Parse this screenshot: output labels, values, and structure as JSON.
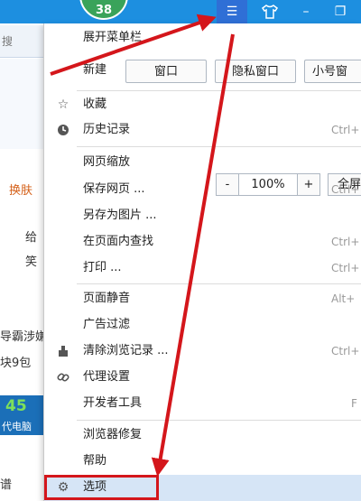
{
  "titlebar": {
    "badge": "38",
    "menu_icon": "hamburger-icon",
    "shirt_icon": "tshirt-icon",
    "min_icon": "minimize-icon",
    "max_icon": "restore-icon",
    "menu_glyph": "☰",
    "min_glyph": "–",
    "max_glyph": "❐"
  },
  "background_page": {
    "search_text": "搜",
    "nav_text": "换肤",
    "line1": "给",
    "line2": "笑",
    "news1": "导霸涉嫌",
    "news2": "块9包",
    "ad_top": "45",
    "ad_bottom": "代电脑",
    "last": "谱"
  },
  "menu": {
    "expand_menubar": "展开菜单栏",
    "new": {
      "label": "新建",
      "window": "窗口",
      "private_window": "隐私窗口",
      "small_window": "小号窗"
    },
    "favorites": {
      "label": "收藏",
      "icon": "star-icon"
    },
    "history": {
      "label": "历史记录",
      "icon": "clock-icon",
      "shortcut": "Ctrl+"
    },
    "zoom": {
      "label": "网页缩放",
      "minus": "-",
      "value": "100%",
      "plus": "+",
      "fullscreen": "全屏"
    },
    "save_page": {
      "label": "保存网页 ...",
      "shortcut": "Ctrl+"
    },
    "save_as_image": {
      "label": "另存为图片 ..."
    },
    "find_in_page": {
      "label": "在页面内查找",
      "shortcut": "Ctrl+"
    },
    "print": {
      "label": "打印 ...",
      "shortcut": "Ctrl+"
    },
    "mute_page": {
      "label": "页面静音",
      "shortcut": "Alt+"
    },
    "ad_filter": {
      "label": "广告过滤"
    },
    "clear_data": {
      "label": "清除浏览记录 ...",
      "icon": "eraser-icon",
      "shortcut": "Ctrl+"
    },
    "proxy": {
      "label": "代理设置",
      "icon": "link-icon"
    },
    "dev_tools": {
      "label": "开发者工具",
      "shortcut": "F"
    },
    "browser_repair": {
      "label": "浏览器修复"
    },
    "help": {
      "label": "帮助"
    },
    "options": {
      "label": "选项",
      "icon": "gear-icon"
    }
  },
  "colors": {
    "titlebar": "#1d8fe0",
    "highlight": "#d6e5f6",
    "annotation_red": "#d4161b"
  }
}
